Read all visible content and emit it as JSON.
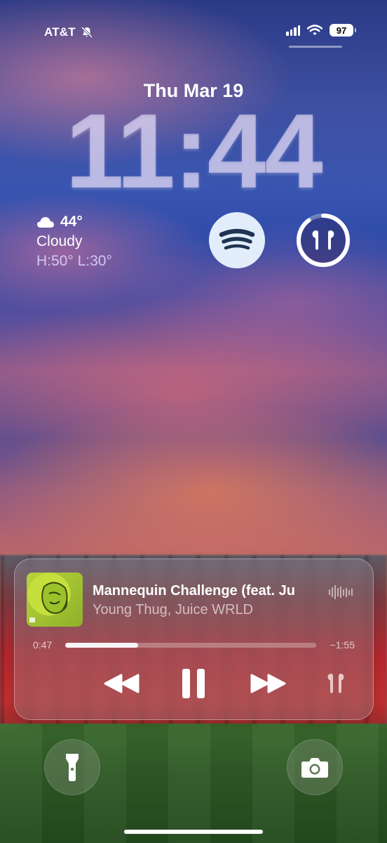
{
  "status_bar": {
    "carrier": "AT&T",
    "silent_icon": "bell-slash-icon",
    "signal_icon": "cellular-signal-icon",
    "wifi_icon": "wifi-icon",
    "battery_level": "97"
  },
  "lock_screen": {
    "date": "Thu Mar 19",
    "time": "11:44"
  },
  "weather": {
    "icon": "cloud-icon",
    "temperature": "44°",
    "condition": "Cloudy",
    "high_low": "H:50° L:30°"
  },
  "widgets": {
    "spotify_icon": "spotify-icon",
    "spotify_color": "#1f3352",
    "airpods_icon": "airpods-icon",
    "airpods_battery_fraction": 0.9
  },
  "now_playing": {
    "title": "Mannequin Challenge (feat. Ju",
    "artist": "Young Thug, Juice WRLD",
    "elapsed": "0:47",
    "remaining": "−1:55",
    "progress_fraction": 0.29,
    "controls": {
      "rewind_icon": "backward-icon",
      "pause_icon": "pause-icon",
      "forward_icon": "forward-icon",
      "route_icon": "airpods-icon"
    }
  },
  "bottom_actions": {
    "flashlight_icon": "flashlight-icon",
    "camera_icon": "camera-icon"
  }
}
